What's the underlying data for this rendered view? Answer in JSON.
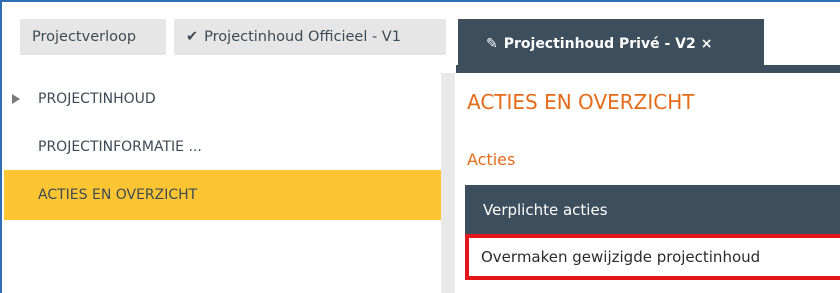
{
  "tabs": [
    {
      "label": "Projectverloop",
      "icon": ""
    },
    {
      "label": "Projectinhoud Officieel - V1",
      "icon": "checkmark-icon"
    },
    {
      "label": "Projectinhoud Privé - V2",
      "icon": "pencil-icon",
      "active": true,
      "close": "×"
    }
  ],
  "sidebar": {
    "items": [
      {
        "label": "PROJECTINHOUD",
        "expand_icon": "triangle-right-icon"
      },
      {
        "label": "PROJECTINFORMATIE ..."
      },
      {
        "label": "ACTIES EN OVERZICHT",
        "selected": true
      }
    ]
  },
  "main": {
    "title": "ACTIES EN OVERZICHT",
    "section": "Acties",
    "panel_header": "Verplichte acties",
    "action": "Overmaken gewijzigde projectinhoud"
  },
  "colors": {
    "accent": "#e56b19",
    "selected": "#fdc531",
    "dark": "#3d4e5c",
    "highlight": "#e3161b"
  }
}
